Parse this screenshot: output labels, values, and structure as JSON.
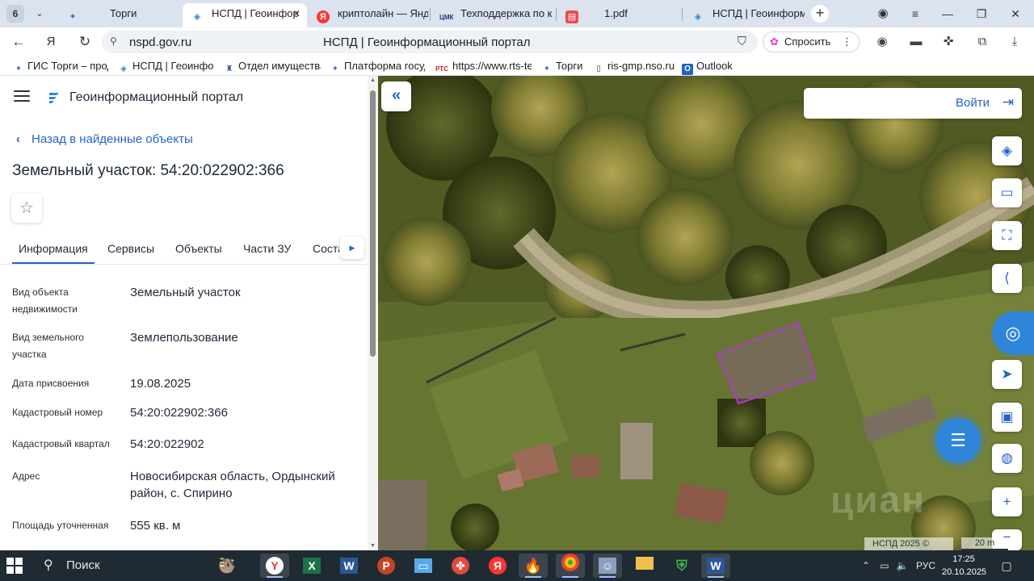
{
  "browser": {
    "tab_count": "6",
    "tabs": [
      {
        "title": "Торги",
        "icon": "gov-eagle-icon",
        "active": false
      },
      {
        "title": "НСПД | Геоинфор",
        "icon": "nspd-icon",
        "active": true
      },
      {
        "title": "криптолайн — Янде",
        "icon": "yandex-icon",
        "active": false
      },
      {
        "title": "Техподдержка по к",
        "icon": "support-icon",
        "active": false
      },
      {
        "title": "1.pdf",
        "icon": "pdf-icon",
        "active": false
      },
      {
        "title": "НСПД | Геоинформ",
        "icon": "nspd-icon",
        "active": false
      }
    ],
    "url": "nspd.gov.ru",
    "page_title": "НСПД | Геоинформационный портал",
    "ask_label": "Спросить",
    "bookmarks": [
      {
        "label": "ГИС Торги – прод",
        "icon": "gov-eagle-icon"
      },
      {
        "label": "НСПД | Геоинфор",
        "icon": "nspd-icon"
      },
      {
        "label": "Отдел имущества",
        "icon": "coat-of-arms-icon"
      },
      {
        "label": "Платформа госуд",
        "icon": "gov-eagle-icon"
      },
      {
        "label": "https://www.rts-te",
        "icon": "rts-icon"
      },
      {
        "label": "Торги",
        "icon": "gov-eagle-icon"
      },
      {
        "label": "ris-gmp.nso.ru",
        "icon": "document-icon"
      },
      {
        "label": "Outlook",
        "icon": "outlook-icon"
      }
    ]
  },
  "portal": {
    "title": "Геоинформационный портал",
    "back_label": "Назад в найденные объекты",
    "object_title": "Земельный участок: 54:20:022902:366",
    "tabs": [
      "Информация",
      "Сервисы",
      "Объекты",
      "Части ЗУ",
      "Соста"
    ],
    "properties": [
      {
        "key": "Вид объекта недвижимости",
        "value": "Земельный участок"
      },
      {
        "key": "Вид земельного участка",
        "value": "Землепользование"
      },
      {
        "key": "Дата присвоения",
        "value": "19.08.2025"
      },
      {
        "key": "Кадастровый номер",
        "value": "54:20:022902:366"
      },
      {
        "key": "Кадастровый квартал",
        "value": "54:20:022902"
      },
      {
        "key": "Адрес",
        "value": "Новосибирская область, Ордынский район, с. Спирино"
      },
      {
        "key": "Площадь уточненная",
        "value": "555 кв. м"
      }
    ]
  },
  "map": {
    "login_label": "Войти",
    "copyright": "НСПД 2025 ©",
    "scale": "20 m",
    "watermark": "циан",
    "parcel_color": "#b23cc8",
    "tools": [
      "layers-icon",
      "ruler-icon",
      "select-area-icon",
      "share-icon",
      "help-icon",
      "locate-icon",
      "print-icon",
      "geolocation-icon",
      "zoom-in-icon",
      "zoom-out-icon"
    ]
  },
  "taskbar": {
    "search_label": "Поиск",
    "lang": "РУС",
    "time": "17:25",
    "date": "20.10.2025"
  }
}
